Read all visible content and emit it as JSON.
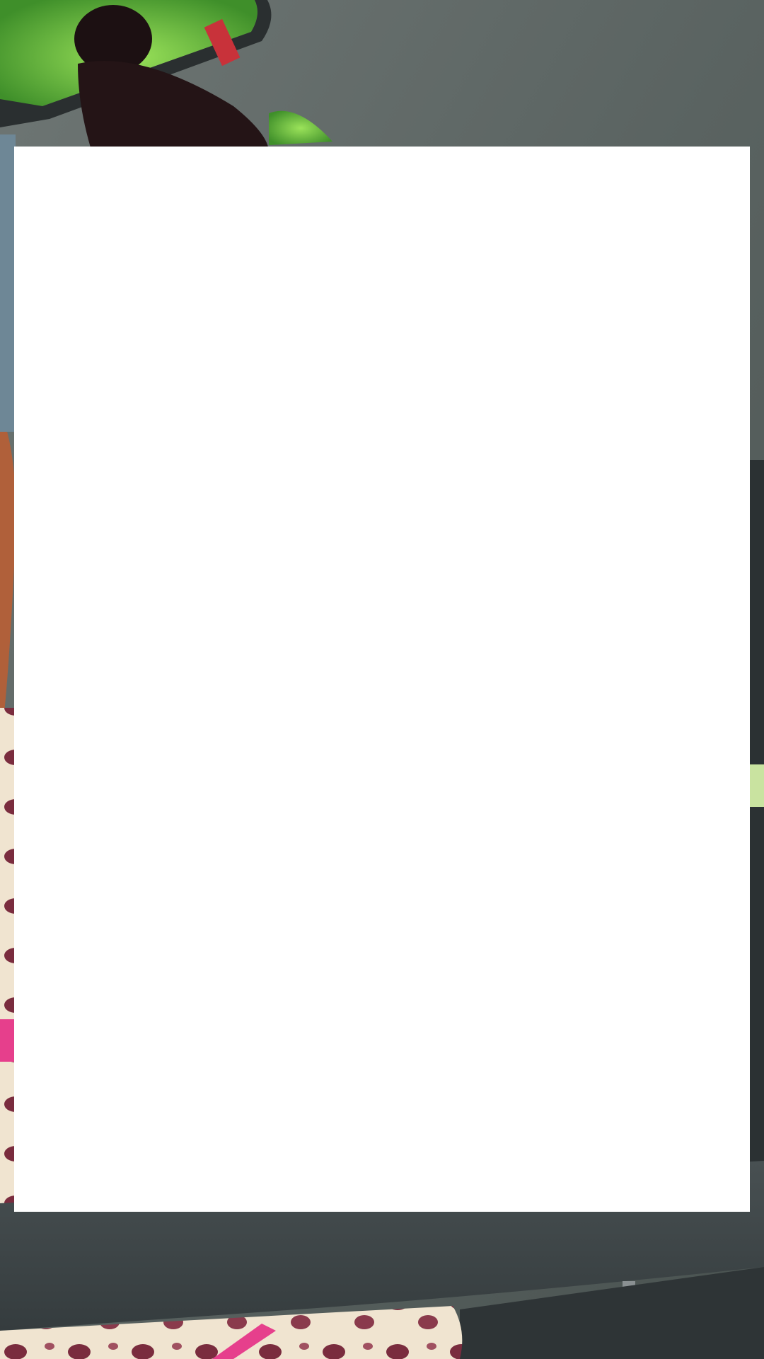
{
  "viewport": {
    "background_photo": "car-interior-camera-frame",
    "overlay": "blank-white-panel"
  },
  "colors": {
    "panel": "#ffffff",
    "headliner": "#5f6866",
    "seat_fabric": "#3d4648",
    "foliage": "#6ecf3a",
    "hair": "#1c1012",
    "leopard_print_base": "#f0e4d0",
    "leopard_spot": "#7a2c3e",
    "strap_pink": "#e63f8c"
  }
}
